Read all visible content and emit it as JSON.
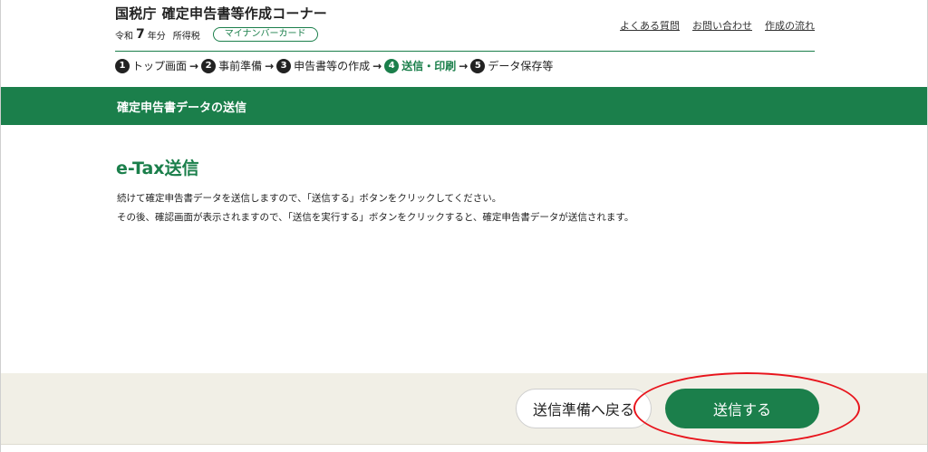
{
  "header": {
    "org": "国税庁",
    "title": "確定申告書等作成コーナー",
    "era": "令和",
    "year": "7",
    "year_suffix": "年分",
    "tax_kind": "所得税",
    "mynumber_badge": "マイナンバーカード",
    "links": [
      "よくある質問",
      "お問い合わせ",
      "作成の流れ"
    ]
  },
  "steps": [
    {
      "num": "1",
      "label": "トップ画面",
      "current": false
    },
    {
      "num": "2",
      "label": "事前準備",
      "current": false
    },
    {
      "num": "3",
      "label": "申告書等の作成",
      "current": false
    },
    {
      "num": "4",
      "label": "送信・印刷",
      "current": true
    },
    {
      "num": "5",
      "label": "データ保存等",
      "current": false
    }
  ],
  "section": {
    "title": "確定申告書データの送信"
  },
  "main": {
    "heading": "e-Tax送信",
    "line1": "続けて確定申告書データを送信しますので、「送信する」ボタンをクリックしてください。",
    "line2": "その後、確認画面が表示されますので、「送信を実行する」ボタンをクリックすると、確定申告書データが送信されます。"
  },
  "actions": {
    "back_label": "送信準備へ戻る",
    "submit_label": "送信する"
  },
  "colors": {
    "brand_green": "#1b7f4b",
    "footer_bg": "#f1efe6",
    "highlight_red": "#e8141c"
  },
  "icons": {
    "arrow": "arrow-right-icon"
  }
}
